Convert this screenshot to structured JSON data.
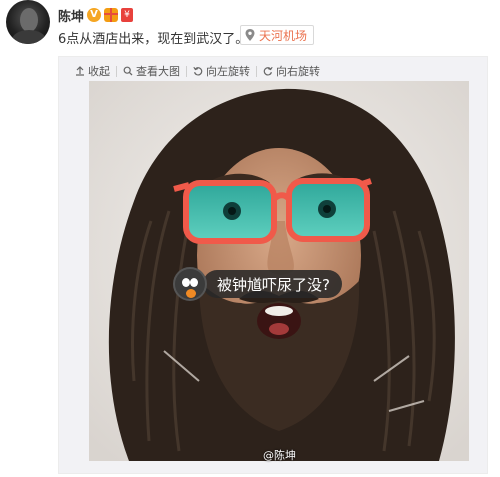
{
  "user": {
    "name": "陈坤",
    "badge_v": "V",
    "badge_red": "¥"
  },
  "post": {
    "text": "6点从酒店出来，现在到武汉了。",
    "location": "天河机场"
  },
  "toolbar": {
    "collapse": "收起",
    "view_large": "查看大图",
    "rotate_left": "向左旋转",
    "rotate_right": "向右旋转"
  },
  "image": {
    "caption": "被钟馗吓尿了没?",
    "watermark": "@陈坤"
  },
  "colors": {
    "accent": "#eb7350",
    "glasses_frame": "#f05a4a",
    "glasses_lens": "#36b8a8"
  }
}
